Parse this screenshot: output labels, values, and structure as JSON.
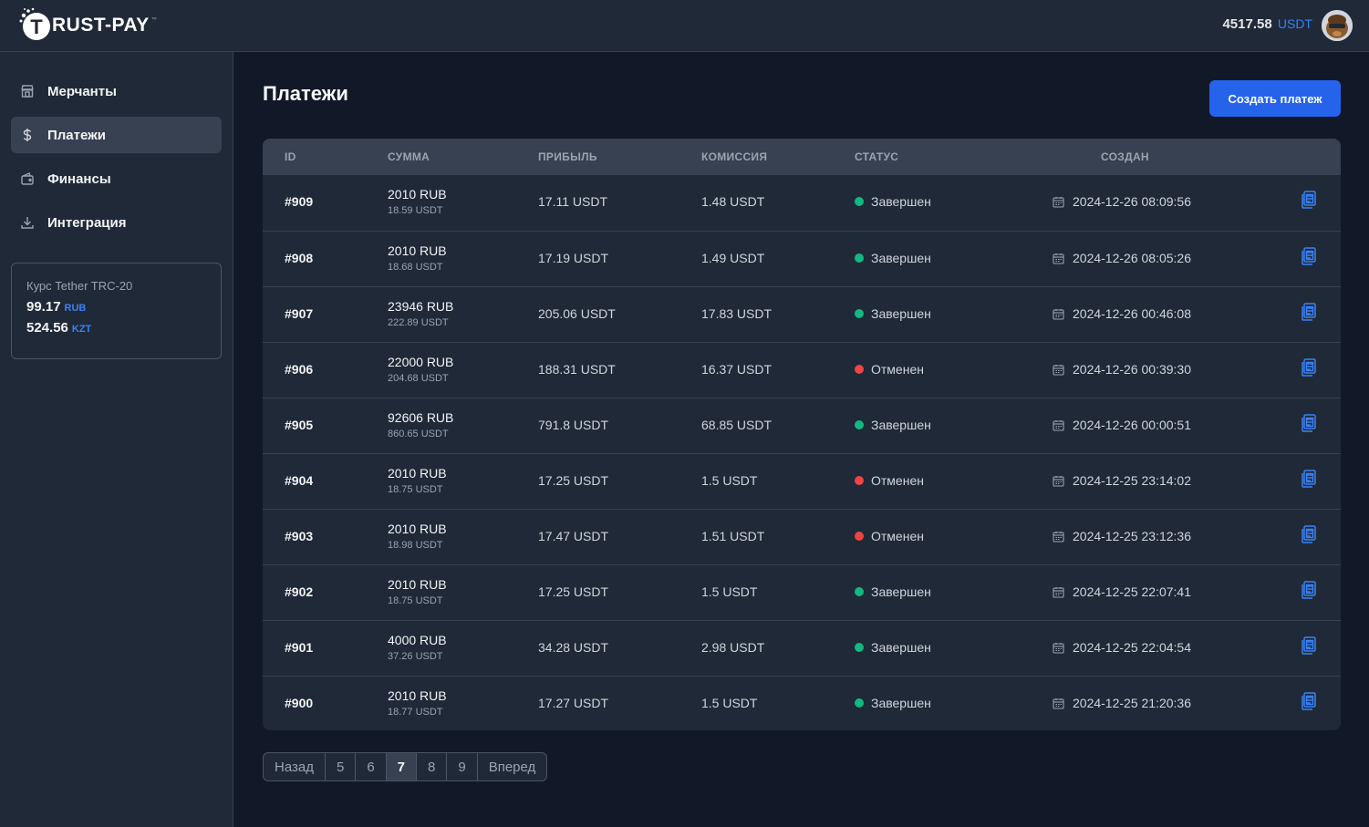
{
  "header": {
    "logo_text": "RUST-PAY",
    "logo_mark": "T",
    "logo_tm": "™",
    "balance_value": "4517.58",
    "balance_currency": "USDT"
  },
  "sidebar": {
    "items": [
      {
        "label": "Мерчанты",
        "icon": "store-icon",
        "active": false
      },
      {
        "label": "Платежи",
        "icon": "dollar-icon",
        "active": true
      },
      {
        "label": "Финансы",
        "icon": "wallet-icon",
        "active": false
      },
      {
        "label": "Интеграция",
        "icon": "download-icon",
        "active": false
      }
    ],
    "rate_card": {
      "title": "Курс Tether TRC-20",
      "rates": [
        {
          "value": "99.17",
          "currency": "RUB"
        },
        {
          "value": "524.56",
          "currency": "KZT"
        }
      ]
    }
  },
  "main": {
    "title": "Платежи",
    "create_button": "Создать платеж"
  },
  "table": {
    "headers": {
      "id": "ID",
      "sum": "СУММА",
      "profit": "ПРИБЫЛЬ",
      "fee": "КОМИССИЯ",
      "status": "СТАТУС",
      "created": "СОЗДАН"
    },
    "rows": [
      {
        "id": "#909",
        "sum": "2010 RUB",
        "sum_usdt": "18.59 USDT",
        "profit": "17.11 USDT",
        "fee": "1.48 USDT",
        "status": "Завершен",
        "status_color": "#10b981",
        "created": "2024-12-26 08:09:56"
      },
      {
        "id": "#908",
        "sum": "2010 RUB",
        "sum_usdt": "18.68 USDT",
        "profit": "17.19 USDT",
        "fee": "1.49 USDT",
        "status": "Завершен",
        "status_color": "#10b981",
        "created": "2024-12-26 08:05:26"
      },
      {
        "id": "#907",
        "sum": "23946 RUB",
        "sum_usdt": "222.89 USDT",
        "profit": "205.06 USDT",
        "fee": "17.83 USDT",
        "status": "Завершен",
        "status_color": "#10b981",
        "created": "2024-12-26 00:46:08"
      },
      {
        "id": "#906",
        "sum": "22000 RUB",
        "sum_usdt": "204.68 USDT",
        "profit": "188.31 USDT",
        "fee": "16.37 USDT",
        "status": "Отменен",
        "status_color": "#ef4444",
        "created": "2024-12-26 00:39:30"
      },
      {
        "id": "#905",
        "sum": "92606 RUB",
        "sum_usdt": "860.65 USDT",
        "profit": "791.8 USDT",
        "fee": "68.85 USDT",
        "status": "Завершен",
        "status_color": "#10b981",
        "created": "2024-12-26 00:00:51"
      },
      {
        "id": "#904",
        "sum": "2010 RUB",
        "sum_usdt": "18.75 USDT",
        "profit": "17.25 USDT",
        "fee": "1.5 USDT",
        "status": "Отменен",
        "status_color": "#ef4444",
        "created": "2024-12-25 23:14:02"
      },
      {
        "id": "#903",
        "sum": "2010 RUB",
        "sum_usdt": "18.98 USDT",
        "profit": "17.47 USDT",
        "fee": "1.51 USDT",
        "status": "Отменен",
        "status_color": "#ef4444",
        "created": "2024-12-25 23:12:36"
      },
      {
        "id": "#902",
        "sum": "2010 RUB",
        "sum_usdt": "18.75 USDT",
        "profit": "17.25 USDT",
        "fee": "1.5 USDT",
        "status": "Завершен",
        "status_color": "#10b981",
        "created": "2024-12-25 22:07:41"
      },
      {
        "id": "#901",
        "sum": "4000 RUB",
        "sum_usdt": "37.26 USDT",
        "profit": "34.28 USDT",
        "fee": "2.98 USDT",
        "status": "Завершен",
        "status_color": "#10b981",
        "created": "2024-12-25 22:04:54"
      },
      {
        "id": "#900",
        "sum": "2010 RUB",
        "sum_usdt": "18.77 USDT",
        "profit": "17.27 USDT",
        "fee": "1.5 USDT",
        "status": "Завершен",
        "status_color": "#10b981",
        "created": "2024-12-25 21:20:36"
      }
    ]
  },
  "pagination": {
    "prev": "Назад",
    "pages": [
      "5",
      "6",
      "7",
      "8",
      "9"
    ],
    "current": "7",
    "next": "Вперед"
  }
}
